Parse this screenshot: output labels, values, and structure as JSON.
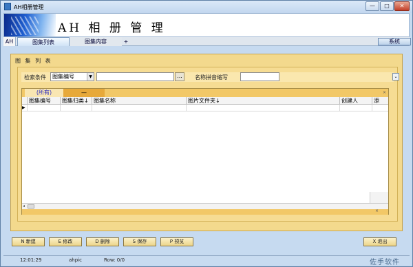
{
  "window": {
    "title": "AH相册管理",
    "min_label": "—",
    "max_label": "□",
    "close_label": "✕"
  },
  "banner": {
    "title": "AH 相 册 管 理"
  },
  "tabs": {
    "ah": "AH",
    "list": "图集列表",
    "content": "图集内容",
    "add": "+",
    "system": "系统"
  },
  "panel": {
    "title": "图 集 列 表"
  },
  "search": {
    "condition_label": "检索条件",
    "field_select": "图集编号",
    "field_arrow": "▼",
    "browse": "...",
    "pinyin_label": "名称拼音缩写",
    "expand": "⌄"
  },
  "grid": {
    "tab_all": "(所有)",
    "tab_dash": "—",
    "close": "×",
    "columns": [
      "图集编号",
      "图集归类↓",
      "图集名称",
      "图片文件夹↓",
      "创建人",
      "添"
    ],
    "row_marker": "▶",
    "scroll_left": "◂",
    "footer_x": "×"
  },
  "buttons": {
    "new": "N 新建",
    "edit": "E 修改",
    "delete": "D 删除",
    "save": "S 保存",
    "preview": "P 预览",
    "exit": "X 退出"
  },
  "status": {
    "time": "12:01:29",
    "db": "ahpic",
    "rows": "Row: 0/0",
    "brand": "佐手软件"
  }
}
